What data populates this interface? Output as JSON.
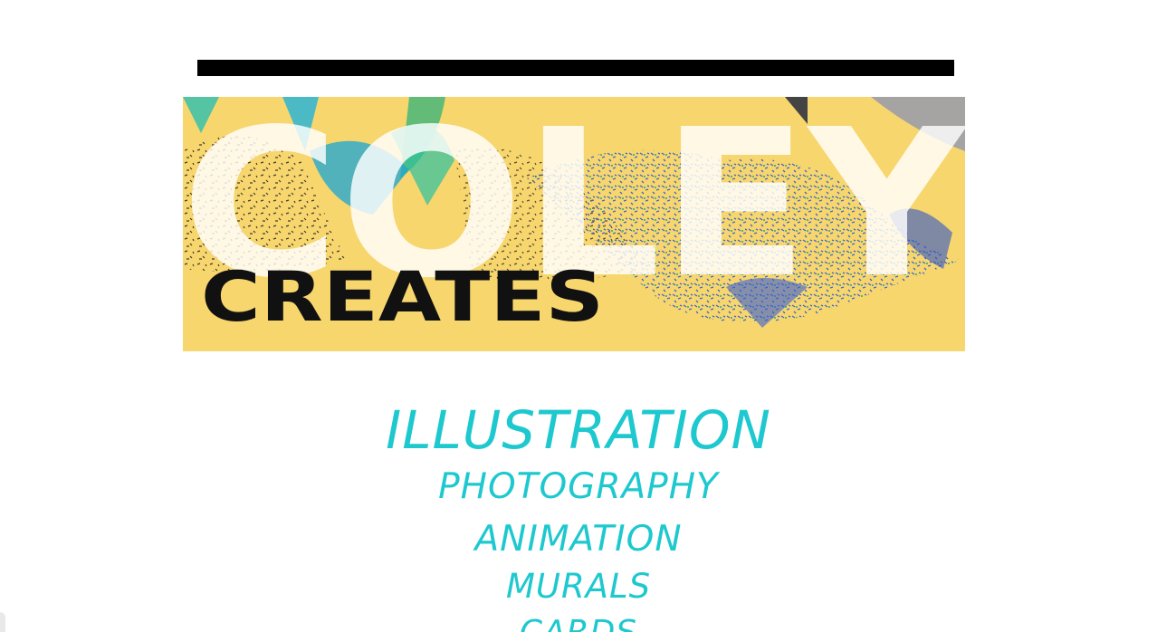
{
  "brand": {
    "logo_word_primary": "COLEY",
    "logo_word_secondary": "CREATES",
    "banner_color": "#f7d66e",
    "accent_color": "#1ec8cf"
  },
  "nav": {
    "items": [
      {
        "label": "ILLUSTRATION"
      },
      {
        "label": "PHOTOGRAPHY"
      },
      {
        "label": "ANIMATION"
      },
      {
        "label": "MURALS"
      },
      {
        "label": "CARDS"
      }
    ]
  }
}
